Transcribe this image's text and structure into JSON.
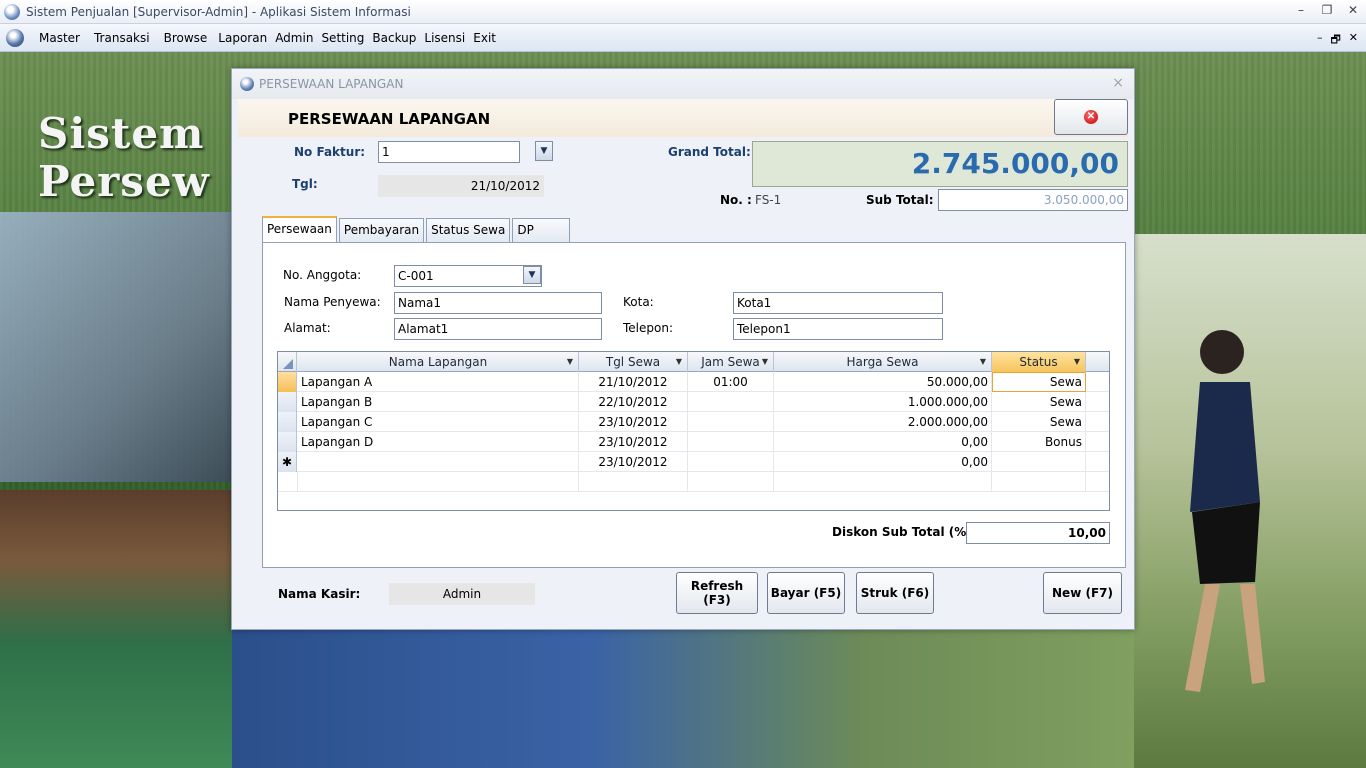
{
  "app": {
    "title": "Sistem Penjualan [Supervisor-Admin] - Aplikasi Sistem Informasi",
    "window_controls": [
      "–",
      "❐",
      "✕"
    ]
  },
  "menu": {
    "items": [
      "Master",
      "Transaksi",
      "Browse",
      "Laporan",
      "Admin",
      "Setting",
      "Backup",
      "Lisensi",
      "Exit"
    ],
    "mdi_controls": [
      "–",
      "🗗",
      "✕"
    ]
  },
  "background": {
    "logo_line1": "Sistem",
    "logo_line2": "Persew"
  },
  "dialog": {
    "window_title": "PERSEWAAN LAPANGAN",
    "close_glyph": "×",
    "form_title": "PERSEWAAN LAPANGAN",
    "close_button_glyph": "✕",
    "no_faktur_label": "No Faktur:",
    "no_faktur_value": "1",
    "tgl_label": "Tgl:",
    "tgl_value": "21/10/2012",
    "grand_total_label": "Grand Total:",
    "grand_total_value": "2.745.000,00",
    "no_label": "No. :",
    "no_value": "FS-1",
    "sub_total_label": "Sub Total:",
    "sub_total_value": "3.050.000,00"
  },
  "tabs": [
    {
      "label": "Persewaan",
      "active": true
    },
    {
      "label": "Pembayaran",
      "active": false
    },
    {
      "label": "Status Sewa",
      "active": false
    },
    {
      "label": "DP",
      "active": false
    }
  ],
  "persewaan": {
    "no_anggota_label": "No. Anggota:",
    "no_anggota_value": "C-001",
    "nama_penyewa_label": "Nama Penyewa:",
    "nama_penyewa_value": "Nama1",
    "kota_label": "Kota:",
    "kota_value": "Kota1",
    "alamat_label": "Alamat:",
    "alamat_value": "Alamat1",
    "telepon_label": "Telepon:",
    "telepon_value": "Telepon1",
    "diskon_label": "Diskon Sub Total (%):",
    "diskon_value": "10,00"
  },
  "grid": {
    "columns": [
      "Nama Lapangan",
      "Tgl Sewa",
      "Jam Sewa",
      "Harga Sewa",
      "Status"
    ],
    "rows": [
      {
        "nama": "Lapangan A",
        "tgl": "21/10/2012",
        "jam": "01:00",
        "harga": "50.000,00",
        "status": "Sewa"
      },
      {
        "nama": "Lapangan B",
        "tgl": "22/10/2012",
        "jam": "",
        "harga": "1.000.000,00",
        "status": "Sewa"
      },
      {
        "nama": "Lapangan C",
        "tgl": "23/10/2012",
        "jam": "",
        "harga": "2.000.000,00",
        "status": "Sewa"
      },
      {
        "nama": "Lapangan D",
        "tgl": "23/10/2012",
        "jam": "",
        "harga": "0,00",
        "status": "Bonus"
      }
    ],
    "new_row": {
      "marker": "✱",
      "tgl": "23/10/2012",
      "harga": "0,00"
    }
  },
  "footer": {
    "nama_kasir_label": "Nama Kasir:",
    "nama_kasir_value": "Admin",
    "refresh_label": "Refresh (F3)",
    "bayar_label": "Bayar (F5)",
    "struk_label": "Struk (F6)",
    "new_label": "New (F7)"
  }
}
